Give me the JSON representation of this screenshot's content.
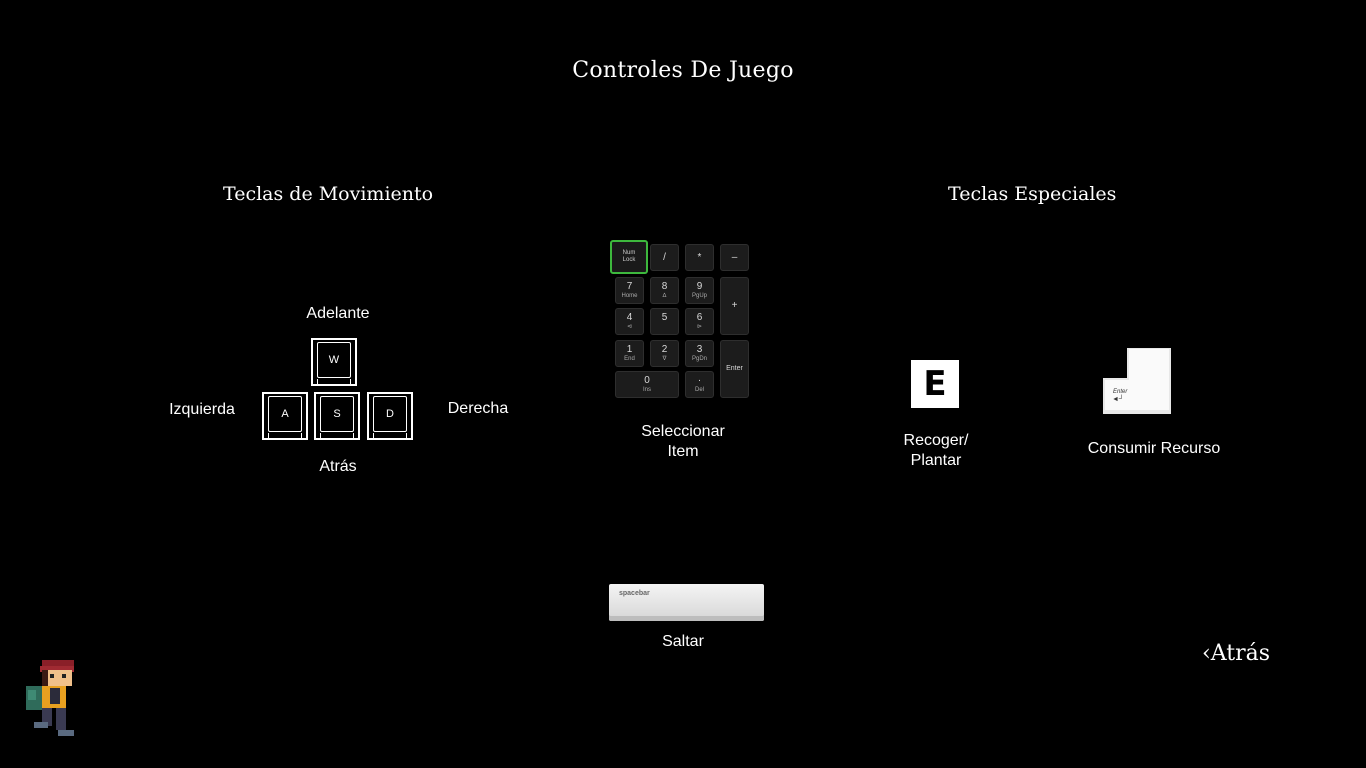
{
  "title": "Controles De Juego",
  "movement": {
    "heading": "Teclas de Movimiento",
    "forward": "Adelante",
    "left": "Izquierda",
    "right": "Derecha",
    "backward": "Atrás",
    "keys": {
      "w": "W",
      "a": "A",
      "s": "S",
      "d": "D"
    }
  },
  "numpad": {
    "caption": "Seleccionar\nItem",
    "keys": {
      "numlock": "Num\nLock",
      "slash": "/",
      "star": "*",
      "minus": "–",
      "plus": "+",
      "enter": "Enter",
      "k7": "7",
      "k7s": "Home",
      "k8": "8",
      "k8s": "∆",
      "k9": "9",
      "k9s": "PgUp",
      "k4": "4",
      "k4s": "⊲",
      "k5": "5",
      "k6": "6",
      "k6s": "⊳",
      "k1": "1",
      "k1s": "End",
      "k2": "2",
      "k2s": "∇",
      "k3": "3",
      "k3s": "PgDn",
      "k0": "0",
      "k0s": "Ins",
      "dot": "·",
      "dots": "Del"
    }
  },
  "special": {
    "heading": "Teclas Especiales",
    "e_key": "E",
    "e_caption": "Recoger/\nPlantar",
    "enter_key": "Enter",
    "enter_caption": "Consumir Recurso"
  },
  "jump": {
    "key": "spacebar",
    "caption": "Saltar"
  },
  "back_button": "‹Atrás"
}
